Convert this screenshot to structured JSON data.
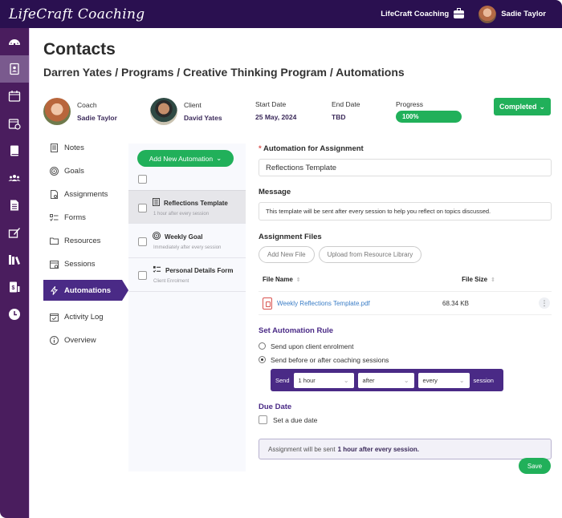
{
  "topbar": {
    "brand": "LifeCraft Coaching",
    "organization": "LifeCraft Coaching",
    "user_name": "Sadie Taylor"
  },
  "rail": {
    "items": [
      {
        "icon": "dashboard-icon",
        "active": false
      },
      {
        "icon": "contacts-icon",
        "active": true
      },
      {
        "icon": "calendar-icon",
        "active": false
      },
      {
        "icon": "calendar-clock-icon",
        "active": false
      },
      {
        "icon": "book-icon",
        "active": false
      },
      {
        "icon": "group-icon",
        "active": false
      },
      {
        "icon": "document-list-icon",
        "active": false
      },
      {
        "icon": "signature-icon",
        "active": false
      },
      {
        "icon": "library-icon",
        "active": false
      },
      {
        "icon": "invoice-icon",
        "active": false
      },
      {
        "icon": "clock-icon",
        "active": false
      }
    ]
  },
  "page": {
    "title": "Contacts",
    "breadcrumb": "Darren Yates / Programs / Creative Thinking Program / Automations"
  },
  "meta": {
    "coach_label": "Coach",
    "coach_name": "Sadie Taylor",
    "client_label": "Client",
    "client_name": "David Yates",
    "start_label": "Start Date",
    "start_value": "25 May, 2024",
    "end_label": "End Date",
    "end_value": "TBD",
    "progress_label": "Progress",
    "progress_value": "100%",
    "progress_fraction": 1.0,
    "status_button": "Completed"
  },
  "subnav": {
    "items": [
      {
        "label": "Notes",
        "icon": "notes-icon"
      },
      {
        "label": "Goals",
        "icon": "target-icon"
      },
      {
        "label": "Assignments",
        "icon": "assignment-icon"
      },
      {
        "label": "Forms",
        "icon": "form-icon"
      },
      {
        "label": "Resources",
        "icon": "folder-icon"
      },
      {
        "label": "Sessions",
        "icon": "calendar-icon"
      },
      {
        "label": "Automations",
        "icon": "lightning-icon",
        "active": true
      },
      {
        "label": "Activity Log",
        "icon": "calendar-check-icon"
      },
      {
        "label": "Overview",
        "icon": "info-icon"
      }
    ]
  },
  "automations": {
    "add_button": "Add New Automation",
    "items": [
      {
        "title": "Reflections Template",
        "subtitle": "1 hour after every session",
        "icon": "document-icon",
        "selected": true
      },
      {
        "title": "Weekly Goal",
        "subtitle": "Immediately after every session",
        "icon": "target-icon",
        "selected": false
      },
      {
        "title": "Personal Details Form",
        "subtitle": "Client Enrolment",
        "icon": "form-icon",
        "selected": false
      }
    ]
  },
  "form": {
    "automation_label": "Automation for Assignment",
    "automation_value": "Reflections Template",
    "message_label": "Message",
    "message_value": "This template will be sent after every session to help you reflect on topics discussed.",
    "files_label": "Assignment Files",
    "add_file_button": "Add New File",
    "upload_button": "Upload from Resource Library",
    "col_file_name": "File Name",
    "col_file_size": "File Size",
    "files": [
      {
        "name": "Weekly Reflections Template.pdf",
        "size": "68.34 KB"
      }
    ],
    "rule_title": "Set Automation Rule",
    "rule_option_1": "Send upon client enrolment",
    "rule_option_2": "Send before or after coaching sessions",
    "rule_send": "Send",
    "rule_amount": "1 hour",
    "rule_when": "after",
    "rule_frequency": "every",
    "rule_session": "session",
    "due_title": "Due Date",
    "due_checkbox": "Set a due date",
    "summary_prefix": "Assignment will be sent",
    "summary_bold": "1 hour after every session.",
    "save_button": "Save"
  }
}
